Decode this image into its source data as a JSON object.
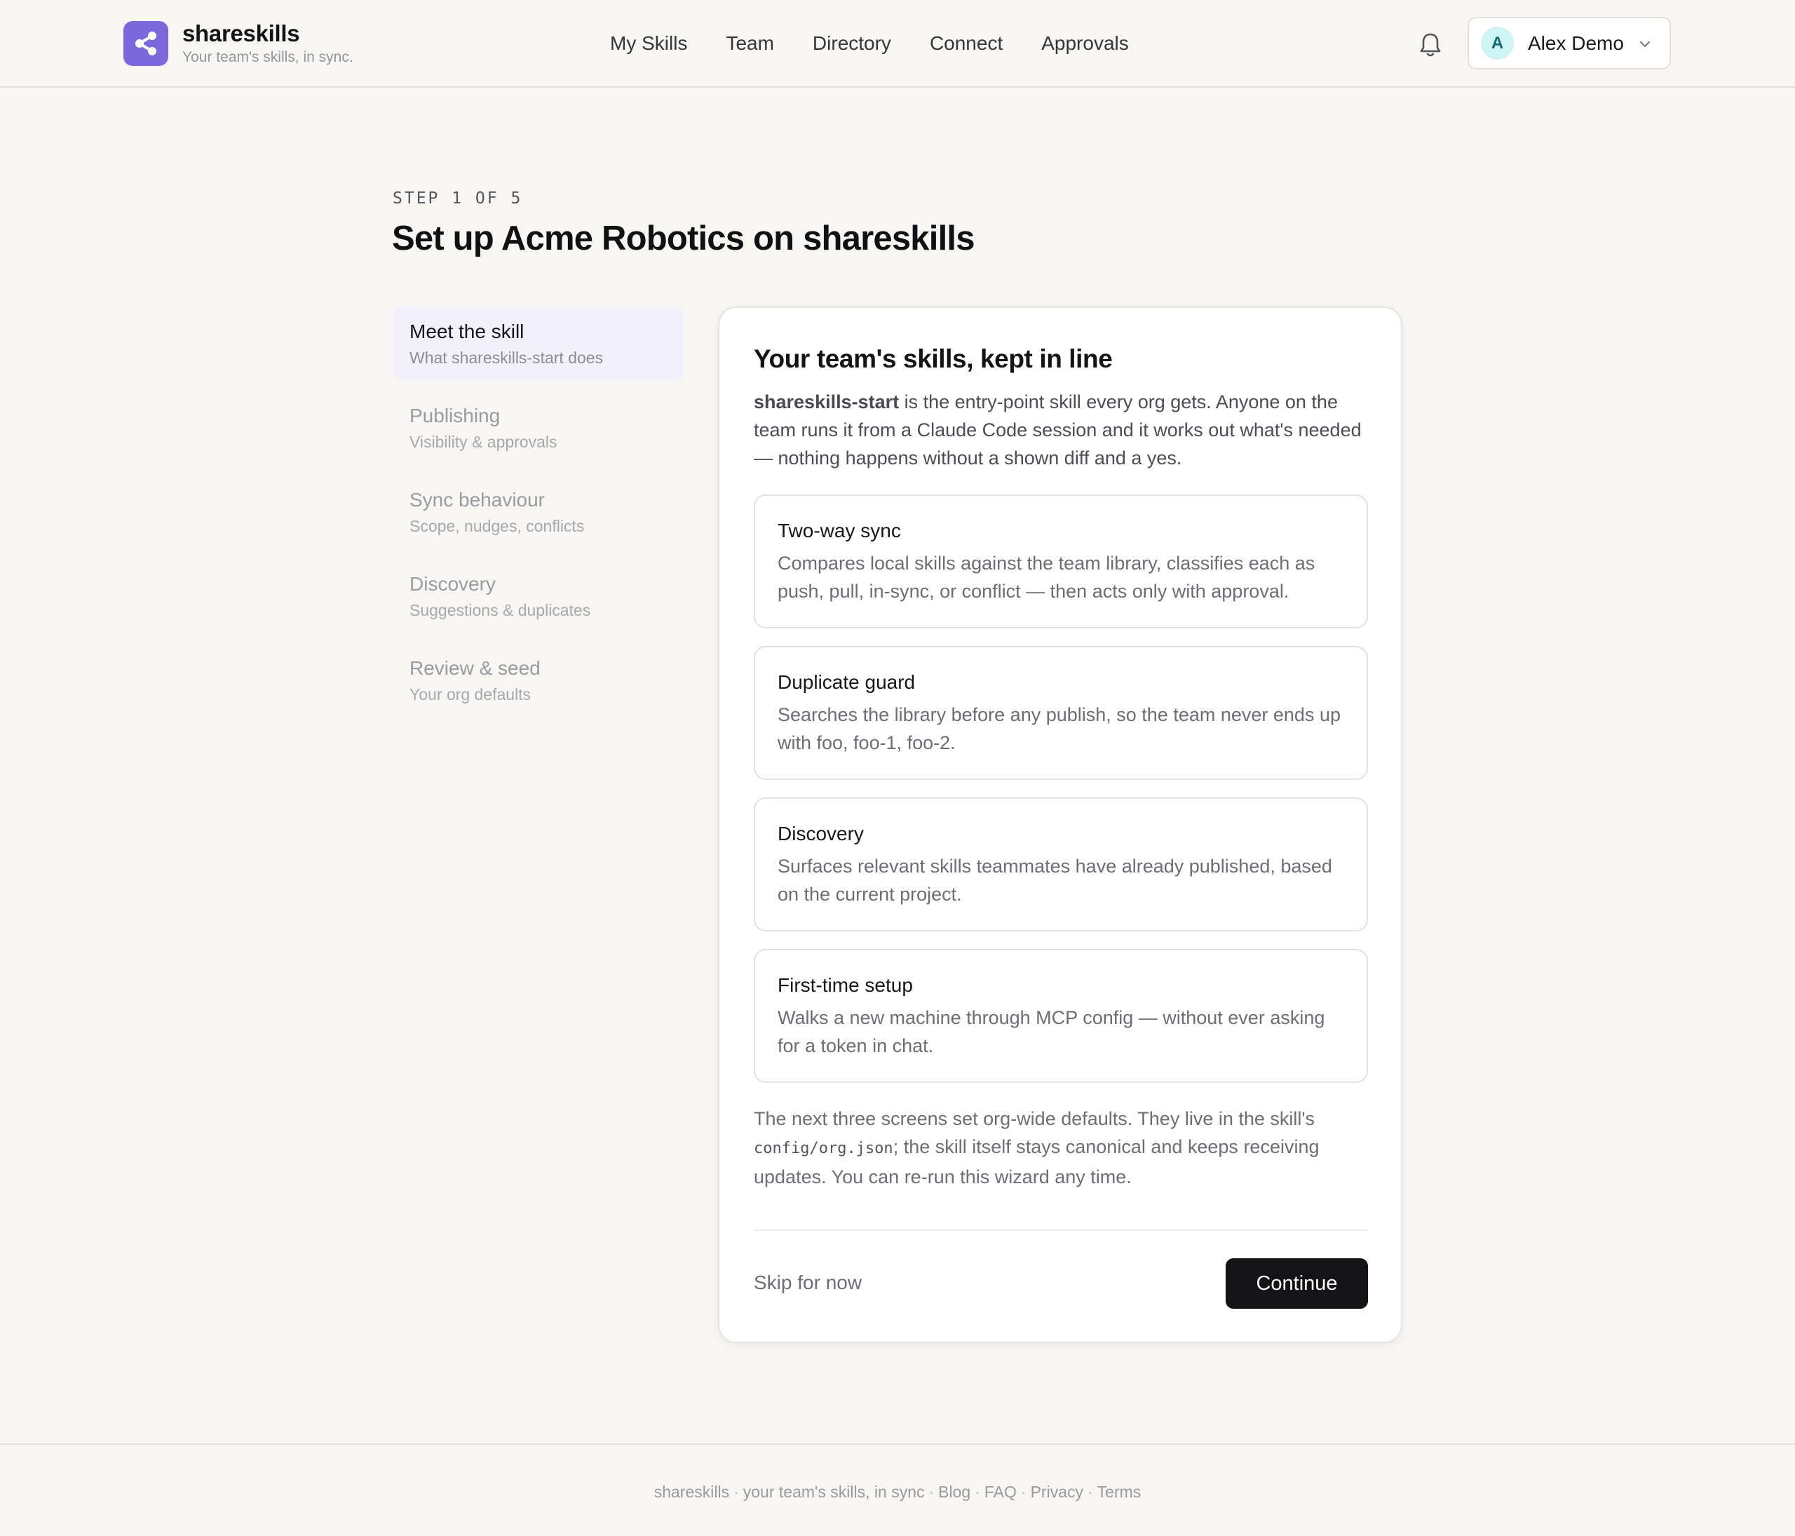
{
  "brand": {
    "name": "shareskills",
    "tagline": "Your team's skills, in sync.",
    "logo_icon": "share-icon",
    "accent": "#7b68dd"
  },
  "nav": {
    "items": [
      {
        "label": "My Skills"
      },
      {
        "label": "Team"
      },
      {
        "label": "Directory"
      },
      {
        "label": "Connect"
      },
      {
        "label": "Approvals"
      }
    ]
  },
  "notifications": {
    "icon": "bell-icon"
  },
  "user": {
    "initial": "A",
    "name": "Alex Demo",
    "menu_icon": "chevron-down-icon"
  },
  "wizard": {
    "step_label": "STEP 1 OF 5",
    "title": "Set up Acme Robotics on shareskills",
    "steps": [
      {
        "title": "Meet the skill",
        "subtitle": "What shareskills-start does",
        "active": true
      },
      {
        "title": "Publishing",
        "subtitle": "Visibility & approvals",
        "active": false
      },
      {
        "title": "Sync behaviour",
        "subtitle": "Scope, nudges, conflicts",
        "active": false
      },
      {
        "title": "Discovery",
        "subtitle": "Suggestions & duplicates",
        "active": false
      },
      {
        "title": "Review & seed",
        "subtitle": "Your org defaults",
        "active": false
      }
    ]
  },
  "card": {
    "title": "Your team's skills, kept in line",
    "intro_strong": "shareskills-start",
    "intro_rest": " is the entry-point skill every org gets. Anyone on the team runs it from a Claude Code session and it works out what's needed — nothing happens without a shown diff and a yes.",
    "features": [
      {
        "title": "Two-way sync",
        "description": "Compares local skills against the team library, classifies each as push, pull, in-sync, or conflict — then acts only with approval."
      },
      {
        "title": "Duplicate guard",
        "description": "Searches the library before any publish, so the team never ends up with foo, foo-1, foo-2."
      },
      {
        "title": "Discovery",
        "description": "Surfaces relevant skills teammates have already published, based on the current project."
      },
      {
        "title": "First-time setup",
        "description": "Walks a new machine through MCP config — without ever asking for a token in chat."
      }
    ],
    "outro_before": "The next three screens set org-wide defaults. They live in the skill's ",
    "outro_code": "config/org.json",
    "outro_after": "; the skill itself stays canonical and keeps receiving updates. You can re-run this wizard any time.",
    "skip_label": "Skip for now",
    "continue_label": "Continue"
  },
  "footer": {
    "brand": "shareskills",
    "tagline": "your team's skills, in sync",
    "links": [
      "Blog",
      "FAQ",
      "Privacy",
      "Terms"
    ]
  }
}
